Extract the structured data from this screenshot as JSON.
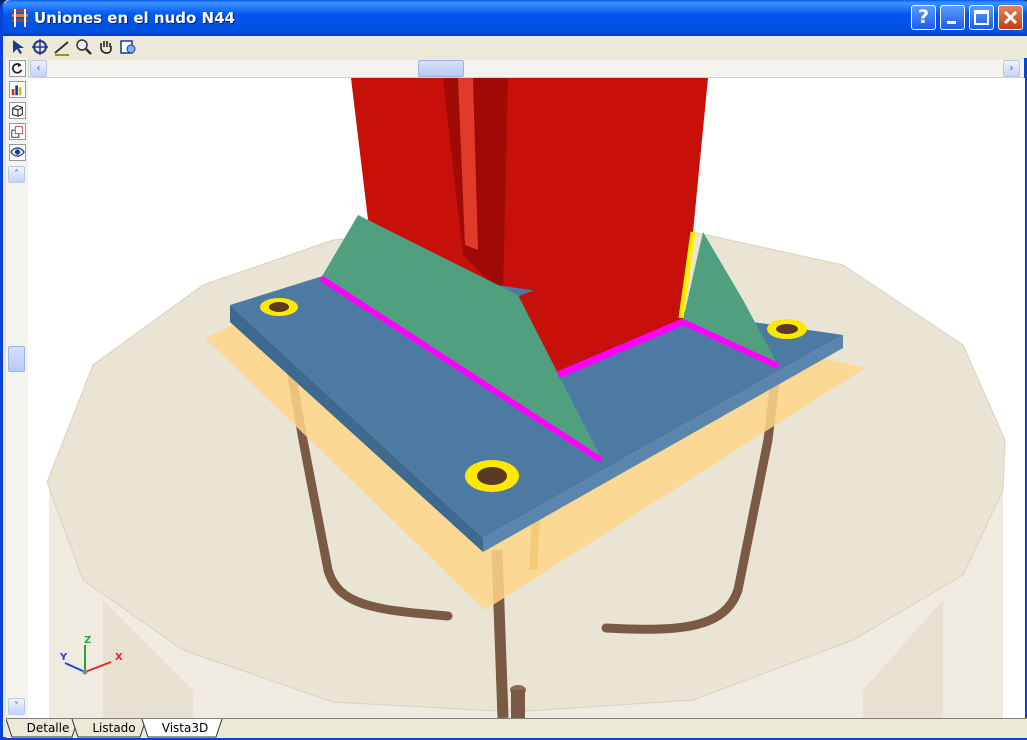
{
  "window": {
    "title": "Uniones en el nudo N44",
    "buttons": {
      "help": "?",
      "minimize": "_",
      "maximize": "□",
      "close": "✕"
    }
  },
  "toolbar": {
    "tools": [
      "select-arrow-icon",
      "zoom-window-icon",
      "measure-icon",
      "zoom-icon",
      "pan-hand-icon",
      "print-preview-icon"
    ]
  },
  "side_toolbar": {
    "tools": [
      "rotate-icon",
      "bar-chart-icon",
      "box-view-icon",
      "layers-icon",
      "eye-view-icon"
    ]
  },
  "scrollbars": {
    "left_arrow": "‹",
    "right_arrow": "›",
    "up_arrow": "˄",
    "down_arrow": "˅"
  },
  "axes": {
    "x": "X",
    "y": "Y",
    "z": "Z"
  },
  "tabs": [
    {
      "label": "Detalle",
      "active": false
    },
    {
      "label": "Listado",
      "active": false
    },
    {
      "label": "Vista3D",
      "active": true
    }
  ],
  "colors": {
    "title_bar": "#0054e3",
    "column": "#c8100a",
    "stiffener": "#50a080",
    "base_plate": "#4d7aa3",
    "grout": "#ffd68a",
    "weld": "#ff00ff",
    "bolt_washer": "#ffe800",
    "anchor_bar": "#7a5a44",
    "pedestal": "#e9e4d3"
  }
}
